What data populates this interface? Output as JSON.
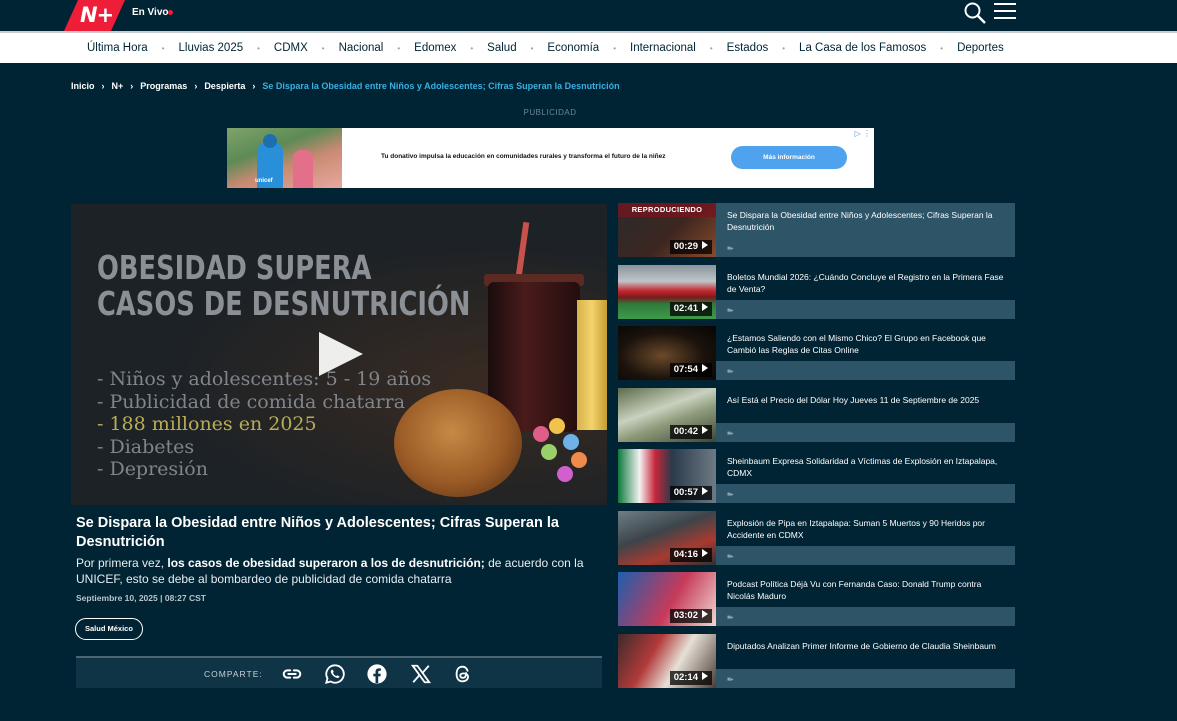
{
  "header": {
    "logo_text": "N+",
    "live_label": "En Vivo",
    "colors": {
      "brand": "#ee1d38",
      "background": "#002434",
      "link_highlight": "#39b0e0"
    }
  },
  "nav": {
    "items": [
      "Última Hora",
      "Lluvias 2025",
      "CDMX",
      "Nacional",
      "Edomex",
      "Salud",
      "Economía",
      "Internacional",
      "Estados",
      "La Casa de los Famosos",
      "Deportes"
    ]
  },
  "breadcrumb": {
    "items": [
      "Inicio",
      "N+",
      "Programas",
      "Despierta"
    ],
    "current": "Se Dispara la Obesidad entre Niños y Adolescentes; Cifras Superan la Desnutrición"
  },
  "ad": {
    "label": "PUBLICIDAD",
    "text": "Tu donativo impulsa la educación en comunidades rurales y transforma el futuro de la niñez",
    "button": "Más información",
    "brand": "unicef"
  },
  "player": {
    "headline_lines": [
      "OBESIDAD SUPERA",
      "CASOS DE DESNUTRICIÓN"
    ],
    "bullets": [
      "- Niños y adolescentes: 5 - 19 años",
      "- Publicidad de comida chatarra",
      "- 188 millones en 2025",
      "- Diabetes",
      "- Depresión"
    ]
  },
  "article": {
    "title": "Se Dispara la Obesidad entre Niños y Adolescentes; Cifras Superan la Desnutrición",
    "desc_before": "Por primera vez, ",
    "desc_bold": "los casos de obesidad superaron a los de desnutrición;",
    "desc_after": " de acuerdo con la UNICEF, esto se debe al bombardeo de publicidad de comida chatarra",
    "date": "Septiembre 10, 2025 | 08:27 CST",
    "tag": "Salud México"
  },
  "share": {
    "label": "COMPARTE:"
  },
  "playlist": {
    "now_playing_label": "REPRODUCIENDO",
    "items": [
      {
        "title": "Se Dispara la Obesidad entre Niños y Adolescentes; Cifras Superan la Desnutrición",
        "duration": "00:29",
        "thumb": "obesidad",
        "active": true
      },
      {
        "title": "Boletos Mundial 2026: ¿Cuándo Concluye el Registro en la Primera Fase de Venta?",
        "duration": "02:41",
        "thumb": "estadio"
      },
      {
        "title": "¿Estamos Saliendo con el Mismo Chico? El Grupo en Facebook que Cambió las Reglas de Citas Online",
        "duration": "07:54",
        "thumb": "noche"
      },
      {
        "title": "Así Está el Precio del Dólar Hoy Jueves 11 de Septiembre de 2025",
        "duration": "00:42",
        "thumb": "dolar"
      },
      {
        "title": "Sheinbaum Expresa Solidaridad a Víctimas de Explosión en Iztapalapa, CDMX",
        "duration": "00:57",
        "thumb": "sheinbaum"
      },
      {
        "title": "Explosión de Pipa en Iztapalapa: Suman 5 Muertos y 90 Heridos por Accidente en CDMX",
        "duration": "04:16",
        "thumb": "pipa"
      },
      {
        "title": "Podcast Política Déjà Vu con Fernanda Caso: Donald Trump contra Nicolás Maduro",
        "duration": "03:02",
        "thumb": "podcast"
      },
      {
        "title": "Diputados Analizan Primer Informe de Gobierno de Claudia Sheinbaum",
        "duration": "02:14",
        "thumb": "diputados"
      }
    ]
  }
}
